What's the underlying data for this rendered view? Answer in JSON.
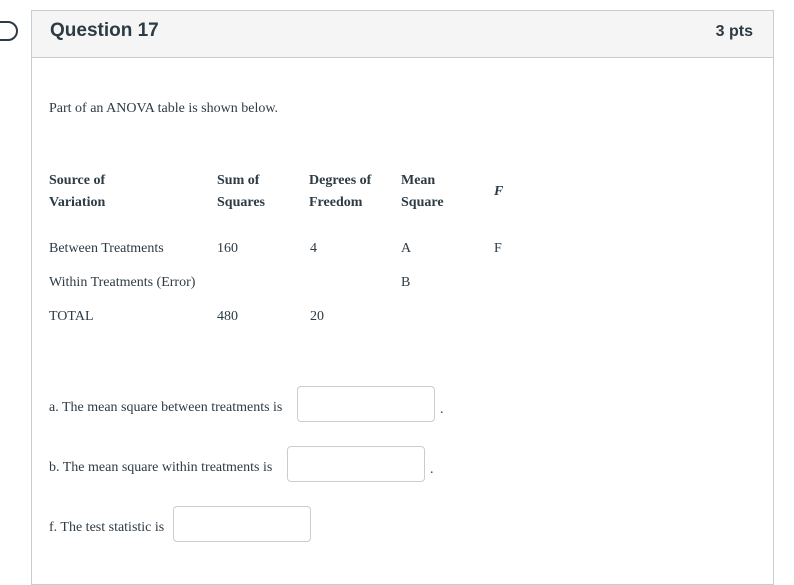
{
  "question": {
    "title": "Question 17",
    "points": "3 pts"
  },
  "intro": "Part of an ANOVA table is shown below.",
  "table": {
    "headers": {
      "source_line1": "Source of",
      "source_line2": "Variation",
      "ss_line1": "Sum of",
      "ss_line2": "Squares",
      "df_line1": "Degrees of",
      "df_line2": "Freedom",
      "ms_line1": "Mean",
      "ms_line2": "Square",
      "f": "F"
    },
    "rows": [
      {
        "source": "Between Treatments",
        "ss": "160",
        "df": "4",
        "ms": "A",
        "f": "F"
      },
      {
        "source": "Within Treatments (Error)",
        "ss": "",
        "df": "",
        "ms": "B",
        "f": ""
      },
      {
        "source": "TOTAL",
        "ss": "480",
        "df": "20",
        "ms": "",
        "f": ""
      }
    ]
  },
  "questions": [
    {
      "label": "a. The mean square between treatments is",
      "value": "",
      "suffix": "."
    },
    {
      "label": "b. The mean square within treatments is",
      "value": "",
      "suffix": "."
    },
    {
      "label": "f. The test statistic is",
      "value": "",
      "suffix": ""
    }
  ]
}
